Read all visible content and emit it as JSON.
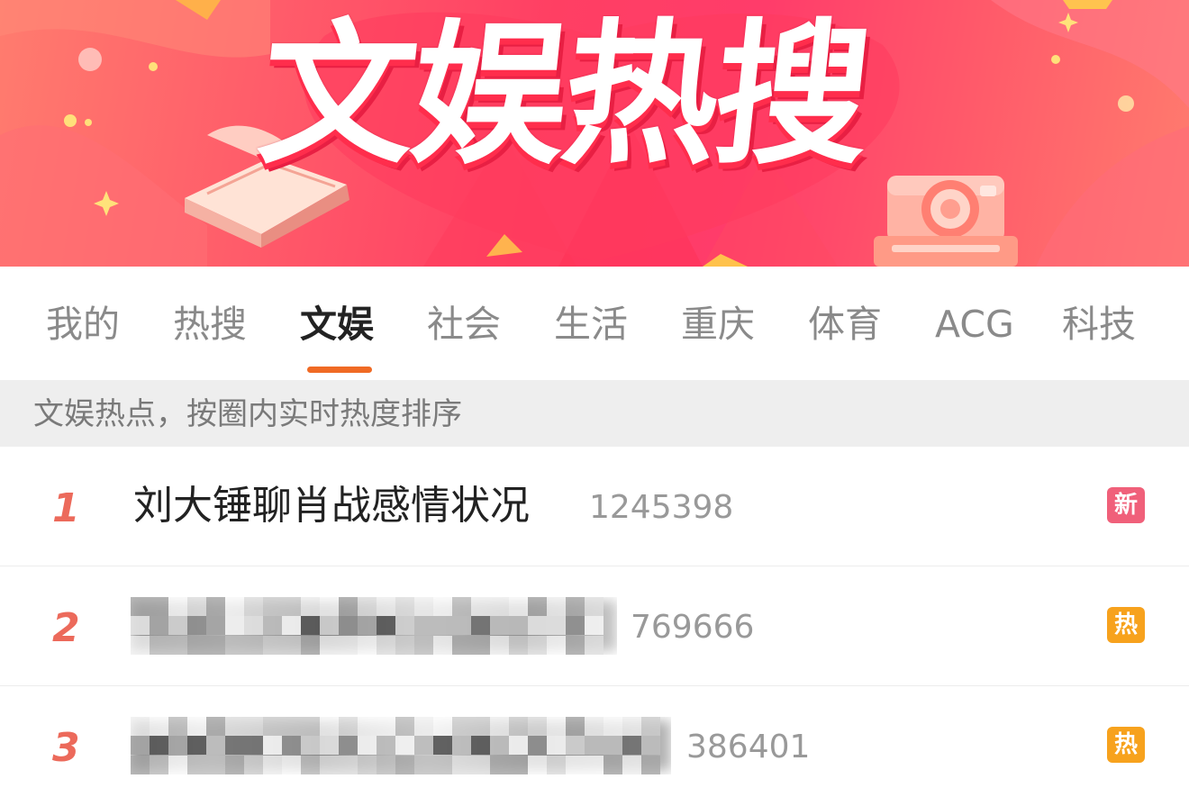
{
  "banner": {
    "title": "文娱热搜",
    "colors": {
      "background": "#ff4f66",
      "title_shadow": "#ff2d4c"
    }
  },
  "tabs": [
    {
      "label": "我的",
      "active": false
    },
    {
      "label": "热搜",
      "active": false
    },
    {
      "label": "文娱",
      "active": true
    },
    {
      "label": "社会",
      "active": false
    },
    {
      "label": "生活",
      "active": false
    },
    {
      "label": "重庆",
      "active": false
    },
    {
      "label": "体育",
      "active": false
    },
    {
      "label": "ACG",
      "active": false
    },
    {
      "label": "科技",
      "active": false
    }
  ],
  "tab_indicator_color": "#f06a24",
  "description": "文娱热点，按圈内实时热度排序",
  "list": [
    {
      "rank": "1",
      "title": "刘大锤聊肖战感情状况",
      "count": "1245398",
      "badge": "新",
      "badge_color": "#f0607a",
      "blurred": false
    },
    {
      "rank": "2",
      "title": "",
      "count": "769666",
      "badge": "热",
      "badge_color": "#f7a21d",
      "blurred": true
    },
    {
      "rank": "3",
      "title": "",
      "count": "386401",
      "badge": "热",
      "badge_color": "#f7a21d",
      "blurred": true
    }
  ]
}
